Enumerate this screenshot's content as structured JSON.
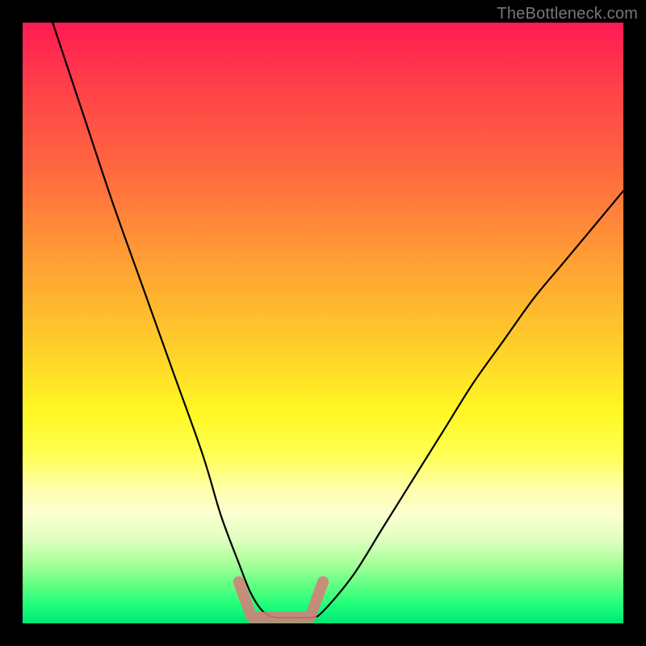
{
  "watermark": "TheBottleneck.com",
  "colors": {
    "background": "#000000",
    "curve": "#000000",
    "tick": "#d77d7a",
    "gradient_top": "#ff1a52",
    "gradient_bottom": "#00e675"
  },
  "chart_data": {
    "type": "line",
    "title": "",
    "xlabel": "",
    "ylabel": "",
    "xlim": [
      0,
      100
    ],
    "ylim": [
      0,
      100
    ],
    "series": [
      {
        "name": "bottleneck-curve",
        "x": [
          5,
          10,
          15,
          20,
          25,
          30,
          33,
          36,
          38,
          40,
          42,
          44,
          48,
          50,
          55,
          60,
          65,
          70,
          75,
          80,
          85,
          90,
          95,
          100
        ],
        "values": [
          100,
          85,
          70,
          56,
          42,
          28,
          18,
          10,
          5,
          2,
          1,
          1,
          1,
          2,
          8,
          16,
          24,
          32,
          40,
          47,
          54,
          60,
          66,
          72
        ]
      }
    ],
    "annotations": [
      {
        "name": "optimal-range-marker",
        "shape": "u-tick",
        "color": "#d77d7a",
        "x_range": [
          36,
          50
        ],
        "y_base": 1
      }
    ],
    "note": "Values are read off the plot by vertical proportion (0 = bottom, 100 = top). No axes or tick labels are shown in the image; x is nominal horizontal position in percent."
  }
}
